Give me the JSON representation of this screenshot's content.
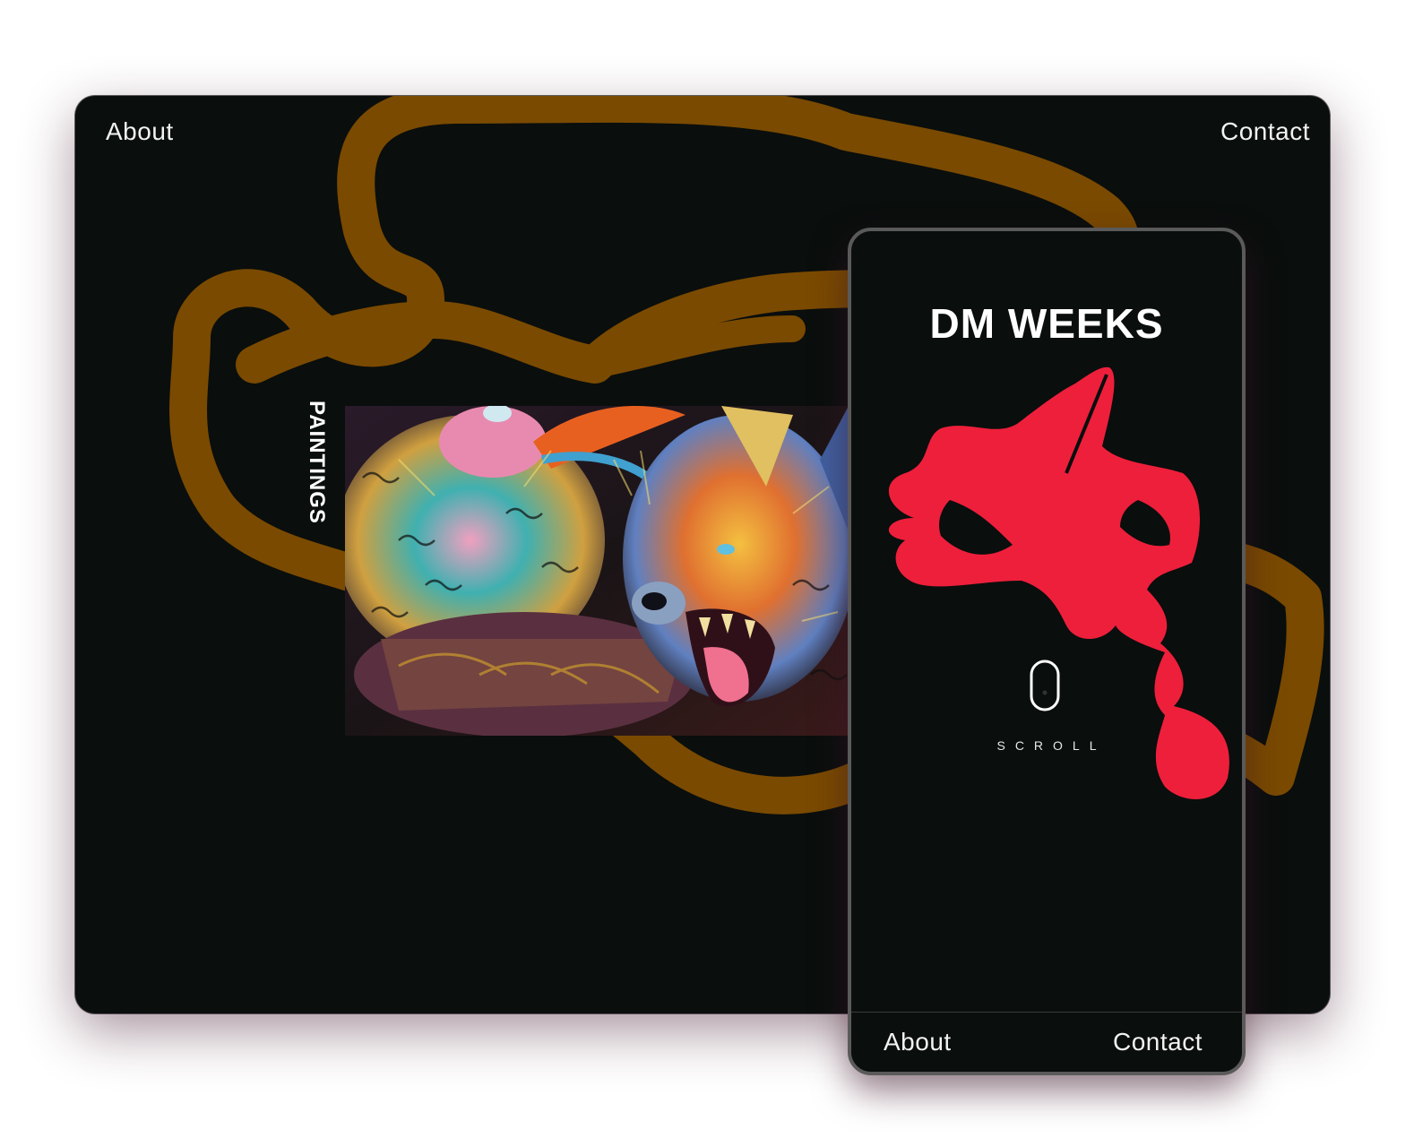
{
  "desktop": {
    "nav": {
      "about": "About",
      "contact": "Contact"
    },
    "section_label": "PAINTINGS",
    "painting_alt": "Expressive painting of a hyena and a colorful bird"
  },
  "phone": {
    "title": "DM WEEKS",
    "scroll_label": "SCROLL",
    "footer": {
      "about": "About",
      "contact": "Contact"
    }
  },
  "colors": {
    "background": "#0a0e0d",
    "swirl": "#7a4a00",
    "splash": "#ee1f3b",
    "text": "#ffffff"
  },
  "icons": [
    "mouse-scroll-icon"
  ]
}
